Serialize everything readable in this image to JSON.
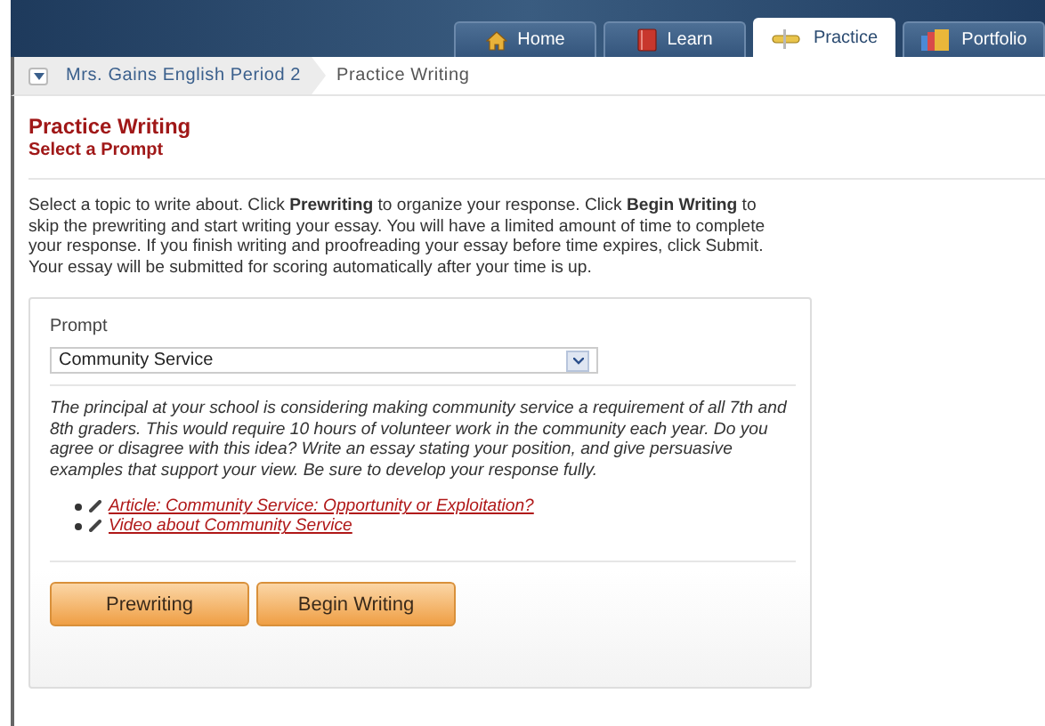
{
  "nav_tabs": [
    {
      "label": "Home",
      "kind": "home",
      "selected": false
    },
    {
      "label": "Learn",
      "kind": "book",
      "selected": false
    },
    {
      "label": "Practice",
      "kind": "pencil",
      "selected": true
    },
    {
      "label": "Portfolio",
      "kind": "folder",
      "selected": false
    }
  ],
  "breadcrumb": {
    "items": [
      "Mrs. Gains English Period 2",
      "Practice Writing"
    ]
  },
  "page": {
    "title": "Practice Writing",
    "subtitle": "Select a Prompt",
    "instructions": "Select a topic to write about. Click **Prewriting** to organize your response. Click **Begin Writing** to skip the prewriting and start writing your essay. You will have a limited amount of time to complete your response. If you finish writing and proofreading your essay before time expires, click Submit. Your essay will be submitted for scoring automatically after your time is up."
  },
  "prompt": {
    "label": "Prompt",
    "value": "Community Service",
    "text": "The principal at your school is considering making community service a requirement of all 7th and 8th graders. This would require 10 hours of volunteer work in the community each year. Do you agree or disagree with this idea? Write an essay stating your position, and give persuasive examples that support your view. Be sure to develop your response fully.",
    "resources": [
      {
        "label": "Article: Community Service: Opportunity or Exploitation?"
      },
      {
        "label": "Video about Community Service"
      }
    ],
    "buttons": [
      "Prewriting",
      "Begin Writing"
    ]
  }
}
